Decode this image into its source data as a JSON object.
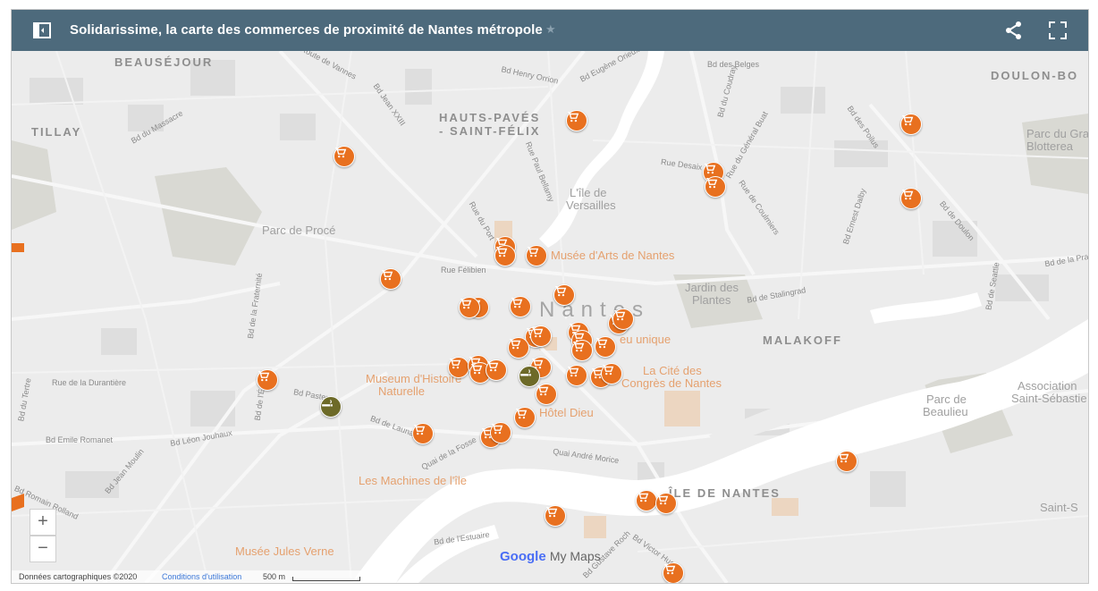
{
  "header": {
    "title": "Solidarissime, la carte des commerces de proximité de Nantes métropole",
    "star_icon": "star-icon",
    "share_icon": "share-icon",
    "fullscreen_icon": "fullscreen-icon",
    "panel_icon": "side-panel-icon"
  },
  "labels": {
    "districts": [
      "BEAUSÉJOUR",
      "TILLAY",
      "HAUTS-PAVÉS",
      "- SAINT-FÉLIX",
      "DOULON-BO",
      "MALAKOFF",
      "ÎLE DE NANTES"
    ],
    "city": "Nantes",
    "pois": [
      "L'île de",
      "Versailles",
      "Parc de Procé",
      "Musée d'Arts de Nantes",
      "Jardin des",
      "Plantes",
      "Museum d'Histoire",
      "Naturelle",
      "La Cité des",
      "Congrès de Nantes",
      "Hôtel Dieu",
      "Les Machines de l'île",
      "Musée Jules Verne",
      "Parc du Gra",
      "Blotterea",
      "Parc de",
      "Beaulieu",
      "Association",
      "Saint-Sébastie",
      "Saint-S",
      "eu unique"
    ],
    "streets": [
      "Route de Vannes",
      "Bd Henry Orrion",
      "Bd Eugène Orieux",
      "Bd des Belges",
      "Bd Jean XXIII",
      "Bd du Massacre",
      "Bd de Launay",
      "Rue Paul Bellamy",
      "Rue Desaix",
      "Bd du Coudray",
      "Rue du Général Buat",
      "Bd des Poilus",
      "Bd Ernest Dalby",
      "Bd de Doulon",
      "Rue Félibien",
      "Rue du Port",
      "Rue de Coulmiers",
      "Bd de la Fraternité",
      "Rue de la Durantière",
      "Bd du Tertre",
      "Bd Emile Romanet",
      "Bd Léon Jouhaux",
      "Bd Jean Moulin",
      "Bd de l'Égalité",
      "Bd Pasteur",
      "Quai de la Fosse",
      "Quai André Morice",
      "Bd de Stalingrad",
      "Bd de Seattle",
      "Bd de la Prairie",
      "Bd de l'Estuaire",
      "Bd Gustave Roch",
      "Bd Victor Hugo",
      "Bd Romain Rolland"
    ]
  },
  "controls": {
    "zoom_in": "+",
    "zoom_out": "−"
  },
  "footer": {
    "map_data": "Données cartographiques ©2020",
    "terms": "Conditions d'utilisation",
    "scale": "500 m"
  },
  "branding": {
    "google": "Google",
    "my_maps": "My Maps"
  },
  "colors": {
    "header_bg": "#4d6a7c",
    "marker_shop": "#e8701f",
    "marker_smoke": "#6d6a28",
    "water": "#ffffff",
    "land": "#ececec"
  },
  "markers": {
    "shop_icon": "shopping-cart-icon",
    "smoke_icon": "cigarette-icon",
    "shop_count": 42,
    "smoke_count": 2
  }
}
